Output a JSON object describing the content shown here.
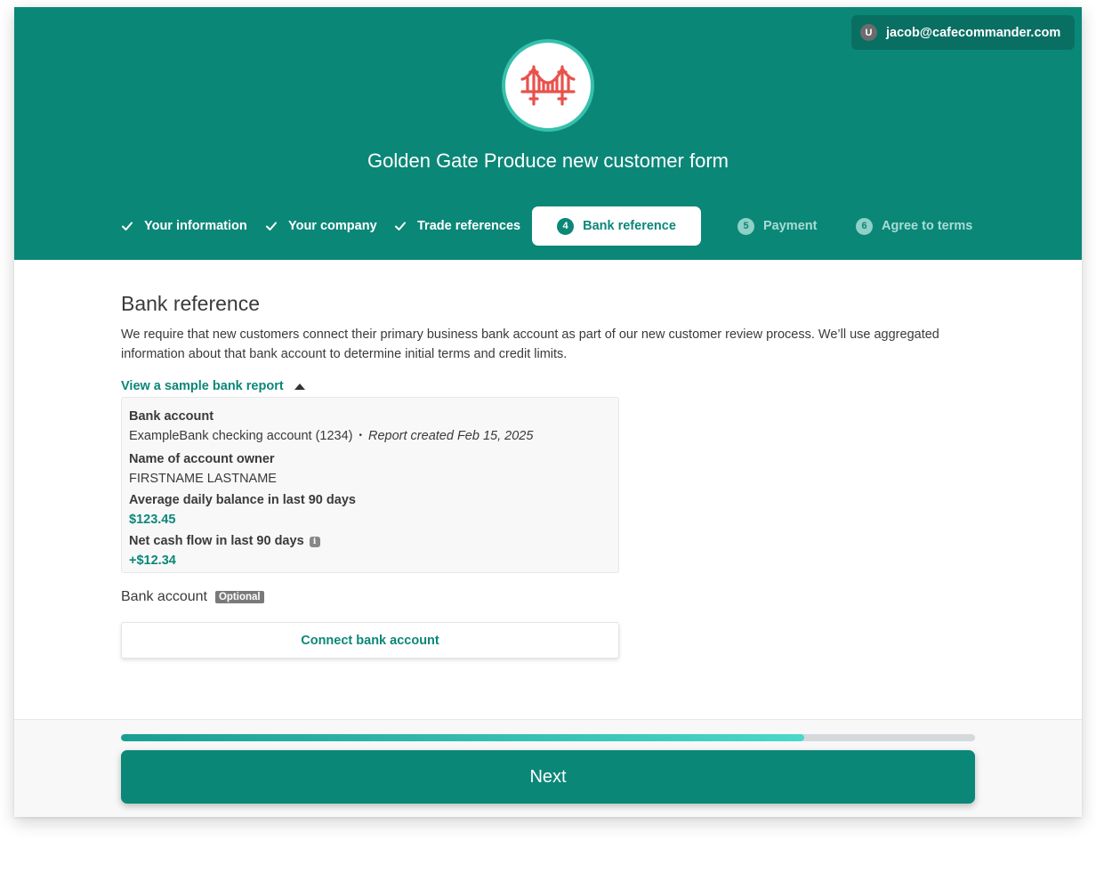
{
  "user": {
    "avatar_initial": "U",
    "email": "jacob@cafecommander.com"
  },
  "header": {
    "title": "Golden Gate Produce new customer form"
  },
  "steps": [
    {
      "label": "Your information",
      "status": "complete"
    },
    {
      "label": "Your company",
      "status": "complete"
    },
    {
      "label": "Trade references",
      "status": "complete"
    },
    {
      "number": "4",
      "label": "Bank reference",
      "status": "active"
    },
    {
      "number": "5",
      "label": "Payment",
      "status": "upcoming"
    },
    {
      "number": "6",
      "label": "Agree to terms",
      "status": "upcoming"
    }
  ],
  "section": {
    "title": "Bank reference",
    "description": "We require that new customers connect their primary business bank account as part of our new customer review process. We’ll use aggregated information about that bank account to determine initial terms and credit limits.",
    "sample_link": "View a sample bank report"
  },
  "report": {
    "bank_account_label": "Bank account",
    "bank_account_value": "ExampleBank checking account (1234)",
    "separator": "•",
    "report_created": "Report created Feb 15, 2025",
    "owner_label": "Name of account owner",
    "owner_value": "FIRSTNAME LASTNAME",
    "avg_balance_label": "Average daily balance in last 90 days",
    "avg_balance_value": "$123.45",
    "cash_flow_label": "Net cash flow in last 90 days",
    "info_glyph": "i",
    "cash_flow_value": "+$12.34"
  },
  "bank_field": {
    "label": "Bank account",
    "optional_tag": "Optional",
    "connect_button": "Connect bank account"
  },
  "footer": {
    "progress_percent": 80,
    "next_button": "Next"
  },
  "colors": {
    "brand": "#0b8778",
    "brand_dark": "#0a6f63",
    "logo_ring": "#36c1ad",
    "logo_bridge": "#e8524c",
    "progress_start": "#1a9e93",
    "progress_end": "#4ad8c8"
  },
  "icons": {
    "logo": "golden-gate-bridge-icon",
    "step_complete": "checkmark-icon",
    "disclosure": "caret-up-icon",
    "info": "info-icon"
  }
}
